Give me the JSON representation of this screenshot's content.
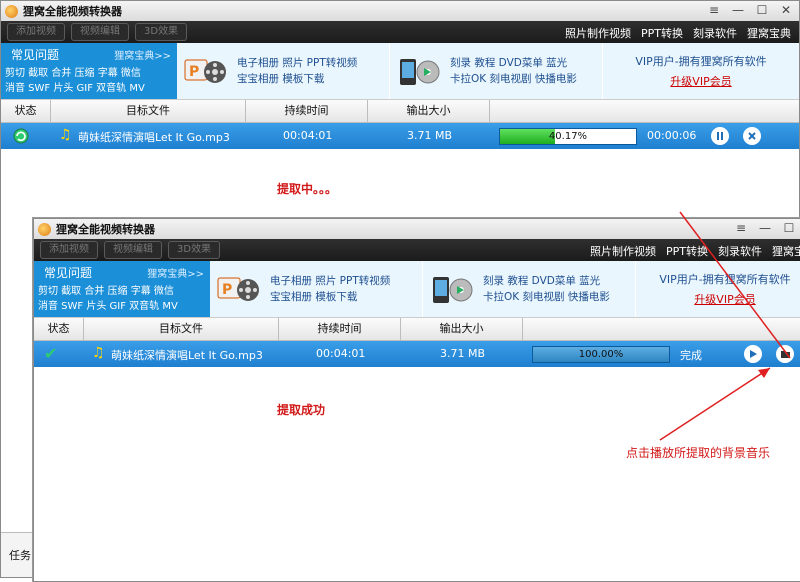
{
  "app_title": "狸窝全能视频转换器",
  "toolbar_buttons": [
    "添加视频",
    "视频编辑",
    "3D效果"
  ],
  "top_links": [
    "照片制作视频",
    "PPT转换",
    "刻录软件",
    "狸窝宝典"
  ],
  "faq": {
    "title": "常见问题",
    "more": "狸窝宝典>>",
    "line1": "剪切 截取 合并 压缩 字幕 微信",
    "line2": "消音 SWF 片头 GIF 双音轨 MV"
  },
  "feature1": {
    "line1": "电子相册 照片 PPT转视频",
    "line2": "宝宝相册 模板下载"
  },
  "feature2": {
    "line1": "刻录 教程 DVD菜单 蓝光",
    "line2": "卡拉OK 刻电视剧 快播电影"
  },
  "vip": {
    "text": "VIP用户-拥有狸窝所有软件",
    "link": "升级VIP会员"
  },
  "table_headers": [
    "状态",
    "目标文件",
    "持续时间",
    "输出大小"
  ],
  "window1": {
    "file": "萌妹纸深情演唱Let It Go.mp3",
    "duration": "00:04:01",
    "size": "3.71 MB",
    "progress_text": "40.17%",
    "progress_value": 40.17,
    "time_left": "00:00:06",
    "message": "提取中。。。"
  },
  "window2": {
    "file": "萌妹纸深情演唱Let It Go.mp3",
    "duration": "00:04:01",
    "size": "3.71 MB",
    "progress_text": "100.00%",
    "progress_value": 100,
    "done_text": "完成",
    "message": "提取成功"
  },
  "annotation": "点击播放所提取的背景音乐",
  "taskbar_label": "任务",
  "colors": {
    "accent": "#1f7fd0",
    "faq_bg": "#1b8fd8",
    "annotation": "#d21a1a"
  }
}
